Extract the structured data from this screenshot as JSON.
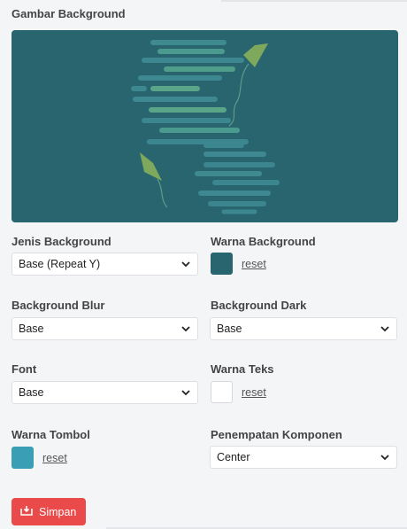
{
  "section": {
    "title": "Gambar Background"
  },
  "fields": {
    "jenis_background": {
      "label": "Jenis Background",
      "value": "Base (Repeat Y)"
    },
    "warna_background": {
      "label": "Warna Background",
      "color": "#29656f",
      "reset_label": "reset"
    },
    "background_blur": {
      "label": "Background Blur",
      "value": "Base"
    },
    "background_dark": {
      "label": "Background Dark",
      "value": "Base"
    },
    "font": {
      "label": "Font",
      "value": "Base"
    },
    "warna_teks": {
      "label": "Warna Teks",
      "color": "#ffffff",
      "reset_label": "reset"
    },
    "warna_tombol": {
      "label": "Warna Tombol",
      "color": "#3a9fb5",
      "reset_label": "reset"
    },
    "penempatan_komponen": {
      "label": "Penempatan Komponen",
      "value": "Center"
    }
  },
  "save_button": {
    "label": "Simpan",
    "color": "#ea4a4a",
    "icon": "save-icon"
  },
  "icons": {
    "dropdown": "chevron-down-icon"
  }
}
